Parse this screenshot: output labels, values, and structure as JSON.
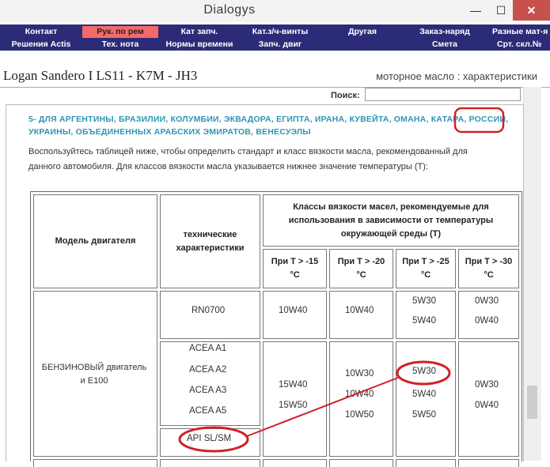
{
  "window": {
    "title": "Dialogys",
    "minimize": "—",
    "maximize": "☐",
    "close": "✕"
  },
  "menu": {
    "row1": [
      "Контакт",
      "Рук. по рем",
      "Кат запч.",
      "Кат.з/ч-винты",
      "Другая",
      "Заказ-наряд",
      "Разные мат-я"
    ],
    "row2": [
      "Решения Actis",
      "Тех. нота",
      "Нормы времени",
      "Запч. двиг",
      "Смета",
      "Срт. скл.№"
    ],
    "active": "Рук. по рем"
  },
  "header": {
    "vehicle": "Logan Sandero I LS11 - K7M - JH3",
    "section": "моторное масло : характеристики"
  },
  "search": {
    "label": "Поиск:",
    "value": ""
  },
  "content": {
    "countries_line1": "5- ДЛЯ АРГЕНТИНЫ, БРАЗИЛИИ, КОЛУМБИИ, ЭКВАДОРА, ЕГИПТА, ИРАНА, КУВЕЙТА, ОМАНА, КАТАРА, РОССИИ,",
    "countries_line2": "УКРАИНЫ, ОБЪЕДИНЕННЫХ АРАБСКИХ ЭМИРАТОВ, ВЕНЕСУЭЛЫ",
    "intro_line1": "Воспользуйтесь таблицей ниже, чтобы определить стандарт и класс вязкости масла, рекомендованный для",
    "intro_line2": "данного автомобиля. Для классов вязкости масла указывается нижнее значение температуры (T):"
  },
  "table": {
    "col_engine": "Модель двигателя",
    "col_tech_1": "технические",
    "col_tech_2": "характеристики",
    "col_classes_1": "Классы вязкости масел, рекомендуемые для",
    "col_classes_2": "использования в зависимости от температуры",
    "col_classes_3": "окружающей среды (T)",
    "temps": [
      {
        "line1": "При Т > -15",
        "line2": "°С"
      },
      {
        "line1": "При Т > -20",
        "line2": "°С"
      },
      {
        "line1": "При Т > -25",
        "line2": "°С"
      },
      {
        "line1": "При Т > -30",
        "line2": "°С"
      }
    ],
    "engine_1": "БЕНЗИНОВЫЙ двигатель",
    "engine_2": "и E100",
    "spec_rn": "RN0700",
    "acea": [
      "ACEA A1",
      "ACEA A2",
      "ACEA A3",
      "ACEA A5"
    ],
    "api": "API SL/SM",
    "row1": {
      "t15": "10W40",
      "t20": "10W40",
      "t25": [
        "5W30",
        "5W40"
      ],
      "t30": [
        "0W30",
        "0W40"
      ]
    },
    "row2": {
      "t15": [
        "15W40",
        "15W50"
      ],
      "t20": [
        "10W30",
        "10W40",
        "10W50"
      ],
      "t25": [
        "5W30",
        "5W40",
        "5W50"
      ],
      "t30": [
        "0W30",
        "0W40"
      ]
    }
  },
  "colors": {
    "menu_bg": "#2c2b78",
    "menu_active": "#f36a6a",
    "countries": "#2f95b6",
    "annotation": "#d0202a",
    "close_button": "#c7524c"
  }
}
